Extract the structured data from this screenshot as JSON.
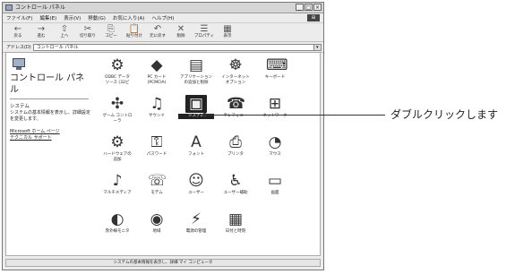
{
  "window": {
    "title": "コントロール パネル",
    "menu": [
      "ファイル(F)",
      "編集(E)",
      "表示(V)",
      "移動(G)",
      "お気に入り(A)",
      "ヘルプ(H)"
    ],
    "toolbar": [
      {
        "icon": "back-icon",
        "glyph": "←",
        "label": "戻る"
      },
      {
        "icon": "forward-icon",
        "glyph": "→",
        "label": "進む"
      },
      {
        "icon": "up-icon",
        "glyph": "⇧",
        "label": "上へ"
      },
      {
        "icon": "cut-icon",
        "glyph": "✂",
        "label": "切り取り"
      },
      {
        "icon": "copy-icon",
        "glyph": "⎘",
        "label": "コピー"
      },
      {
        "icon": "paste-icon",
        "glyph": "📋",
        "label": "貼り付け"
      },
      {
        "icon": "undo-icon",
        "glyph": "↶",
        "label": "元に戻す"
      },
      {
        "icon": "delete-icon",
        "glyph": "✕",
        "label": "削除"
      },
      {
        "icon": "properties-icon",
        "glyph": "☰",
        "label": "プロパティ"
      },
      {
        "icon": "views-icon",
        "glyph": "▦",
        "label": "表示"
      }
    ],
    "address_label": "アドレス(D)",
    "address_value": "コントロール パネル"
  },
  "left_pane": {
    "title": "コントロール パネル",
    "selected_heading": "システム",
    "selected_desc": "システムの基本情報を表示し、詳細設定を変更します。",
    "links": [
      "Microsoft ホーム ページ",
      "テクニカル サポート"
    ]
  },
  "items": [
    {
      "name": "odbc",
      "label": "ODBC データ\nソース (32ビ",
      "glyph": "⚙"
    },
    {
      "name": "pc-card",
      "label": "PC カード\n(PCMCIA)",
      "glyph": "◆"
    },
    {
      "name": "add-remove",
      "label": "アプリケーション\nの追加と削除",
      "glyph": "▤"
    },
    {
      "name": "internet-options",
      "label": "インターネット\nオプション",
      "glyph": "☸"
    },
    {
      "name": "keyboard",
      "label": "キーボード",
      "glyph": "⌨"
    },
    {
      "name": "game-controllers",
      "label": "ゲーム コントロ\nーラ",
      "glyph": "✣"
    },
    {
      "name": "sound",
      "label": "サウンド",
      "glyph": "♫"
    },
    {
      "name": "system",
      "label": "システム",
      "glyph": "▣",
      "selected": true
    },
    {
      "name": "telephony",
      "label": "テレフォニー",
      "glyph": "☎"
    },
    {
      "name": "network",
      "label": "ネットワーク",
      "glyph": "⊞"
    },
    {
      "name": "add-hardware",
      "label": "ハードウェアの\n追加",
      "glyph": "⚙"
    },
    {
      "name": "passwords",
      "label": "パスワード",
      "glyph": "⚿"
    },
    {
      "name": "fonts",
      "label": "フォント",
      "glyph": "A"
    },
    {
      "name": "printers",
      "label": "プリンタ",
      "glyph": "⎙"
    },
    {
      "name": "mouse",
      "label": "マウス",
      "glyph": "◔"
    },
    {
      "name": "multimedia",
      "label": "マルチメディア",
      "glyph": "♪"
    },
    {
      "name": "modems",
      "label": "モデム",
      "glyph": "☏"
    },
    {
      "name": "users",
      "label": "ユーザー",
      "glyph": "☺"
    },
    {
      "name": "accessibility",
      "label": "ユーザー補助",
      "glyph": "♿"
    },
    {
      "name": "display",
      "label": "画面",
      "glyph": "▭"
    },
    {
      "name": "infrared",
      "label": "赤外線モニタ",
      "glyph": "◐"
    },
    {
      "name": "regional",
      "label": "地域",
      "glyph": "◉"
    },
    {
      "name": "power",
      "label": "電源の管理",
      "glyph": "⚡"
    },
    {
      "name": "date-time",
      "label": "日付と時刻",
      "glyph": "▦"
    }
  ],
  "status_text": "システムの基本情報を表示し、詳細 マイ コンピュータ",
  "callout": "ダブルクリックします"
}
